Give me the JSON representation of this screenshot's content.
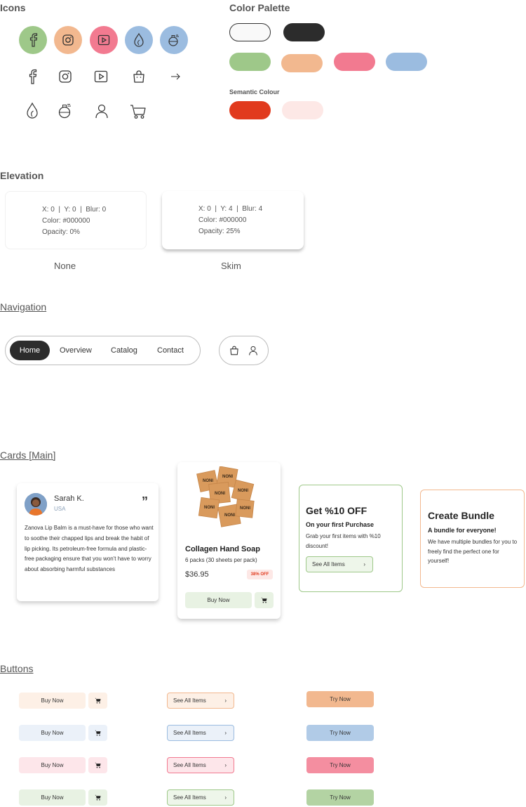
{
  "sections": {
    "icons": "Icons",
    "palette": "Color Palette",
    "semantic": "Semantic Colour",
    "elevation": "Elevation",
    "navigation": "Navigation",
    "cards": "Cards [Main]",
    "buttons": "Buttons"
  },
  "colors": {
    "green": "#9ec889",
    "peach": "#f2b88f",
    "pink": "#f27a90",
    "blue": "#9bbce0",
    "dark": "#2c2c2c",
    "white": "#f9f9f9",
    "red": "#e13a1d",
    "light_red": "#fde8e6"
  },
  "icons": {
    "row1": [
      "facebook-icon",
      "instagram-icon",
      "youtube-icon",
      "water-drop-icon",
      "perfume-icon"
    ],
    "row2": [
      "facebook-icon",
      "instagram-icon",
      "youtube-icon",
      "bag-icon",
      "arrow-right-icon"
    ],
    "row3": [
      "water-drop-icon",
      "perfume-icon",
      "user-icon",
      "cart-icon"
    ]
  },
  "elevation": {
    "none": {
      "line1": "X: 0  |  Y: 0  |  Blur: 0",
      "line2": "Color: #000000",
      "line3": "Opacity: 0%",
      "label": "None"
    },
    "skim": {
      "line1": "X: 0  |  Y: 4  |  Blur: 4",
      "line2": "Color: #000000",
      "line3": "Opacity: 25%",
      "label": "Skim"
    }
  },
  "nav": {
    "items": [
      "Home",
      "Overview",
      "Catalog",
      "Contact"
    ],
    "active": "Home"
  },
  "review": {
    "name": "Sarah K.",
    "country": "USA",
    "quote_mark": "”",
    "text": "Zanova Lip Balm is a must-have for those who want to soothe their chapped lips and break the habit of lip picking. Its petroleum-free formula and plastic-free packaging ensure that you won't have to worry about absorbing harmful substances"
  },
  "product": {
    "brand": "NONI",
    "title": "Collagen Hand Soap",
    "subtitle": "6 packs (30 sheets per pack)",
    "price": "$36.95",
    "badge": "38% OFF",
    "buy": "Buy Now"
  },
  "offer": {
    "title": "Get %10 OFF",
    "subtitle": "On your first Purchase",
    "text": "Grab your first items with %10 discount!",
    "button": "See All Items",
    "chevron": "›"
  },
  "bundle": {
    "title": "Create Bundle",
    "subtitle": "A bundle for everyone!",
    "text": "We have multiple bundles for you to freely find the perfect one for yourself!"
  },
  "buttons": {
    "buy": "Buy Now",
    "see_all": "See All Items",
    "chevron": "›",
    "try": "Try Now"
  }
}
